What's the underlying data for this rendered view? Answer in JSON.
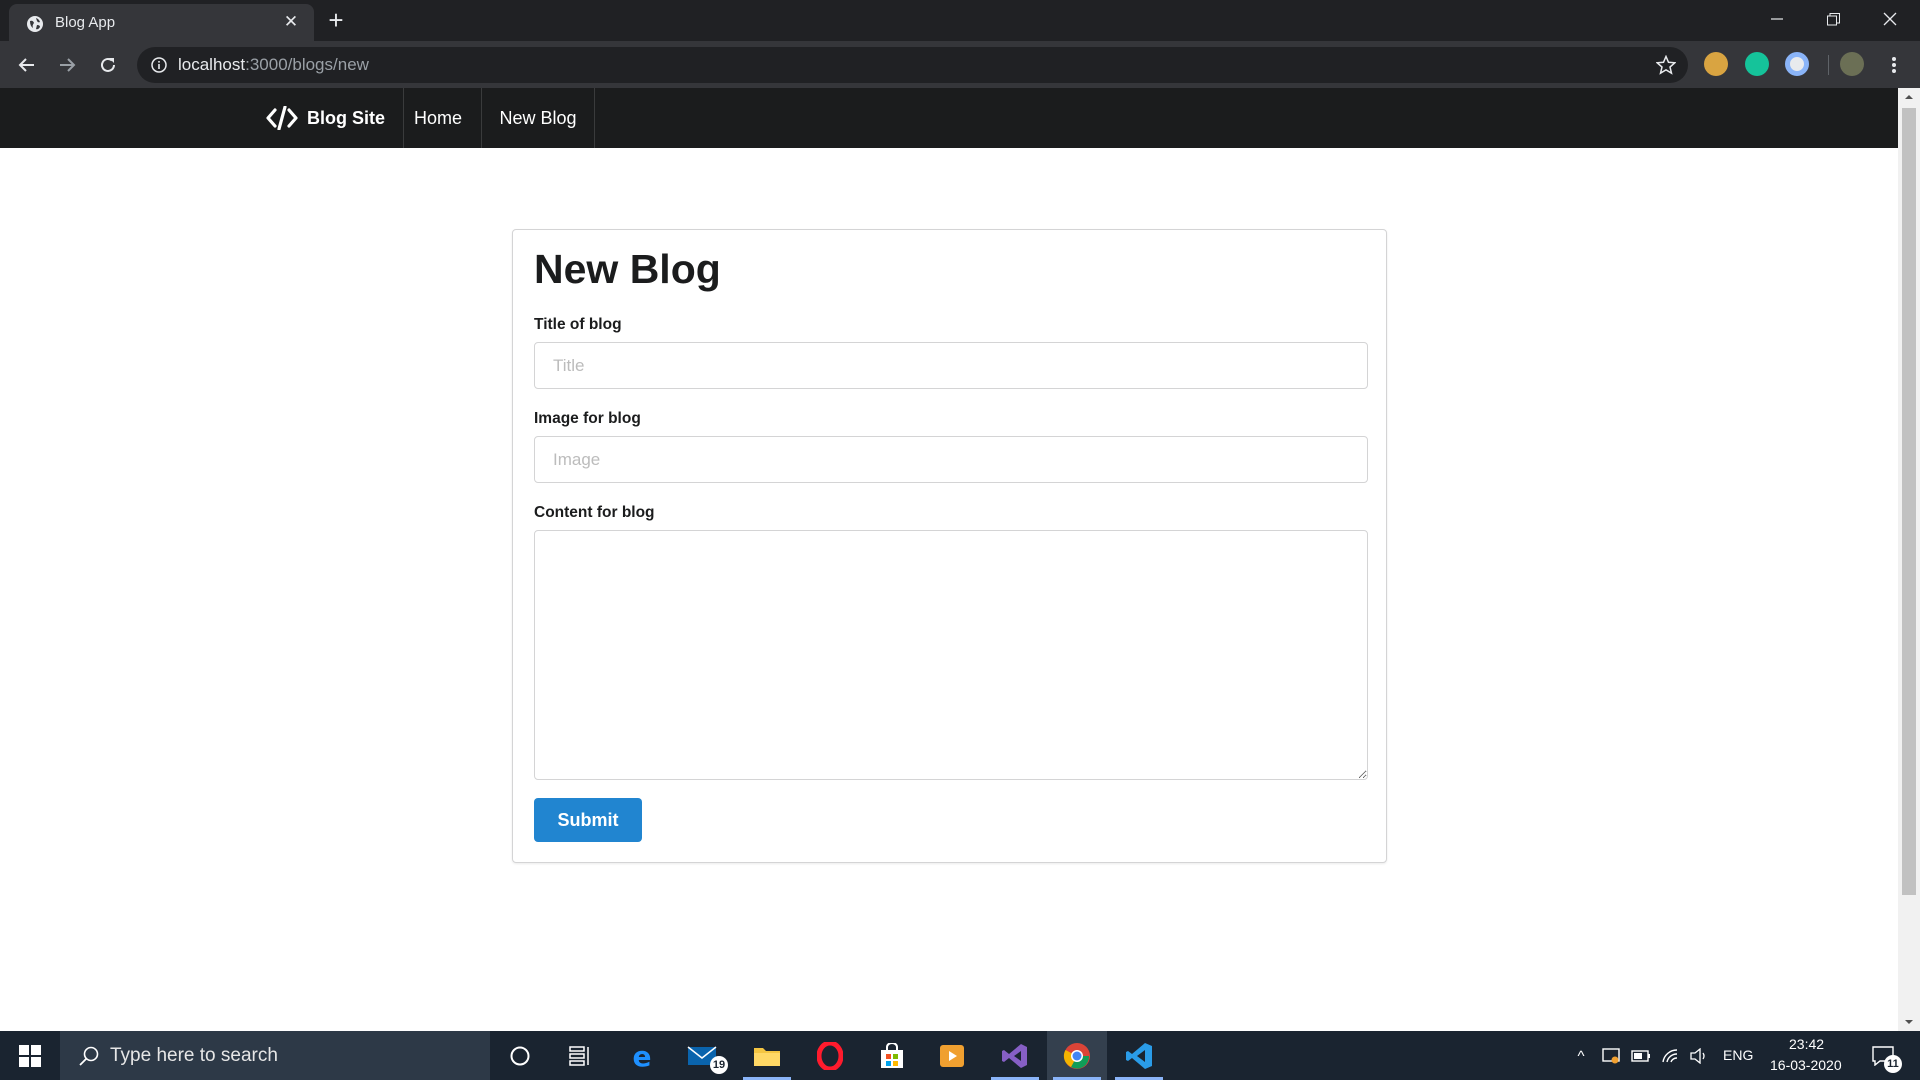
{
  "browser": {
    "tab_title": "Blog App",
    "url_host": "localhost",
    "url_path": ":3000/blogs/new"
  },
  "site": {
    "brand": "Blog Site",
    "nav": [
      {
        "label": "Home"
      },
      {
        "label": "New Blog"
      }
    ]
  },
  "form": {
    "heading": "New Blog",
    "title_label": "Title of blog",
    "title_placeholder": "Title",
    "title_value": "",
    "image_label": "Image for blog",
    "image_placeholder": "Image",
    "image_value": "",
    "content_label": "Content for blog",
    "content_value": "",
    "submit_label": "Submit",
    "submit_color": "#2185d0"
  },
  "taskbar": {
    "search_placeholder": "Type here to search",
    "mail_badge": "19",
    "language": "ENG",
    "time": "23:42",
    "date": "16-03-2020",
    "notifications": "11"
  },
  "colors": {
    "nav_bg": "#1b1c1d",
    "chrome_bg": "#202124",
    "toolbar_bg": "#35363a",
    "taskbar_bg": "#1a2430"
  }
}
